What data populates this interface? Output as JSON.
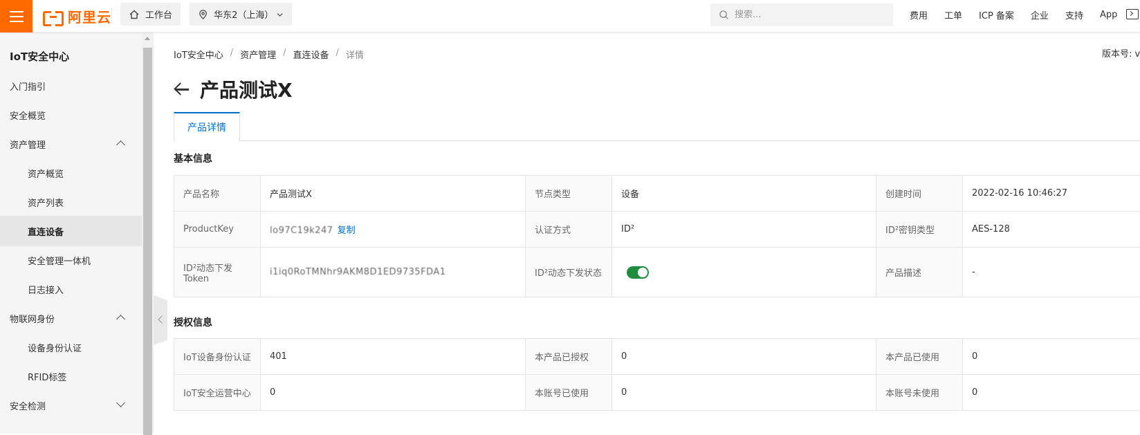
{
  "header": {
    "logo_text": "阿里云",
    "workbench_label": "工作台",
    "region_label": "华东2（上海）",
    "search_placeholder": "搜索...",
    "links": [
      "费用",
      "工单",
      "ICP 备案",
      "企业",
      "支持",
      "App"
    ]
  },
  "sidebar": {
    "title": "IoT安全中心",
    "items": [
      {
        "label": "入门指引",
        "level": 1
      },
      {
        "label": "安全概览",
        "level": 1
      },
      {
        "label": "资产管理",
        "level": 1,
        "expanded": true
      },
      {
        "label": "资产概览",
        "level": 2
      },
      {
        "label": "资产列表",
        "level": 2
      },
      {
        "label": "直连设备",
        "level": 2,
        "active": true
      },
      {
        "label": "安全管理一体机",
        "level": 2
      },
      {
        "label": "日志接入",
        "level": 2
      },
      {
        "label": "物联网身份",
        "level": 1,
        "expanded": true
      },
      {
        "label": "设备身份认证",
        "level": 2
      },
      {
        "label": "RFID标签",
        "level": 2
      },
      {
        "label": "安全检测",
        "level": 1,
        "expanded": false
      }
    ]
  },
  "main": {
    "breadcrumb": [
      "IoT安全中心",
      "资产管理",
      "直连设备",
      "详情"
    ],
    "version_label": "版本号: v",
    "title": "产品测试X",
    "tab": "产品详情",
    "basic_section": "基本信息",
    "basic_rows": [
      [
        {
          "k": "产品名称",
          "v": "产品测试X"
        },
        {
          "k": "节点类型",
          "v": "设备"
        },
        {
          "k": "创建时间",
          "v": "2022-02-16 10:46:27"
        }
      ],
      [
        {
          "k": "ProductKey",
          "v": "lo97C19k247"
        },
        {
          "k": "认证方式",
          "v": "ID²"
        },
        {
          "k": "ID²密钥类型",
          "v": "AES-128"
        }
      ],
      [
        {
          "k": "ID²动态下发Token",
          "v": "i1iq0RoTMNhr9AKM8D1ED9735FDA1"
        },
        {
          "k": "ID²动态下发状态",
          "v": ""
        },
        {
          "k": "产品描述",
          "v": "-"
        }
      ]
    ],
    "copy_label": "复制",
    "auth_section": "授权信息",
    "auth_rows": [
      [
        {
          "k": "IoT设备身份认证",
          "v": "401"
        },
        {
          "k": "本产品已授权",
          "v": "0"
        },
        {
          "k": "本产品已使用",
          "v": "0"
        }
      ],
      [
        {
          "k": "IoT安全运营中心",
          "v": "0"
        },
        {
          "k": "本账号已使用",
          "v": "0"
        },
        {
          "k": "本账号未使用",
          "v": "0"
        }
      ]
    ],
    "toggle_on": true
  }
}
